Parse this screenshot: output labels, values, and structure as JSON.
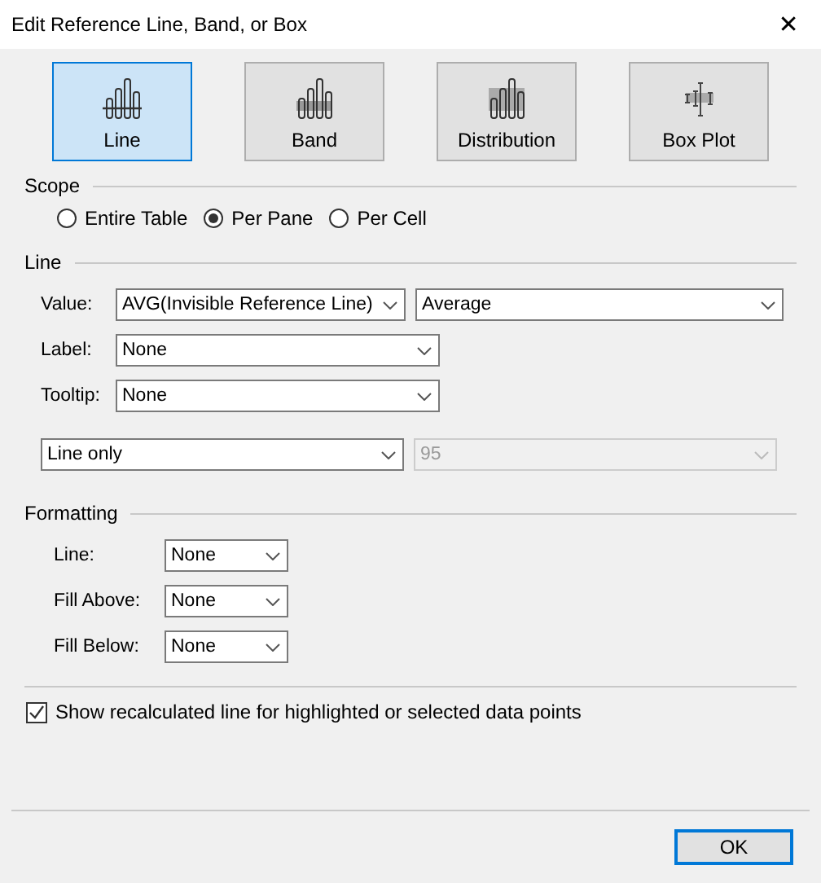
{
  "window": {
    "title": "Edit Reference Line, Band, or Box",
    "close": "✕"
  },
  "types": [
    {
      "label": "Line",
      "kind": "line",
      "selected": true
    },
    {
      "label": "Band",
      "kind": "band",
      "selected": false
    },
    {
      "label": "Distribution",
      "kind": "distribution",
      "selected": false
    },
    {
      "label": "Box Plot",
      "kind": "boxplot",
      "selected": false
    }
  ],
  "scope": {
    "title": "Scope",
    "options": [
      {
        "label": "Entire Table",
        "selected": false
      },
      {
        "label": "Per Pane",
        "selected": true
      },
      {
        "label": "Per Cell",
        "selected": false
      }
    ]
  },
  "line": {
    "title": "Line",
    "value_label": "Value:",
    "value": "AVG(Invisible Reference Line)",
    "aggregation": "Average",
    "label_label": "Label:",
    "label": "None",
    "tooltip_label": "Tooltip:",
    "tooltip": "None",
    "display": "Line only",
    "confidence": {
      "value": "95",
      "disabled": true
    }
  },
  "formatting": {
    "title": "Formatting",
    "rows": [
      {
        "label": "Line:",
        "value": "None"
      },
      {
        "label": "Fill Above:",
        "value": "None"
      },
      {
        "label": "Fill Below:",
        "value": "None"
      }
    ]
  },
  "recalc": {
    "label": "Show recalculated line for highlighted or selected data points",
    "checked": true
  },
  "buttons": [
    "OK"
  ]
}
